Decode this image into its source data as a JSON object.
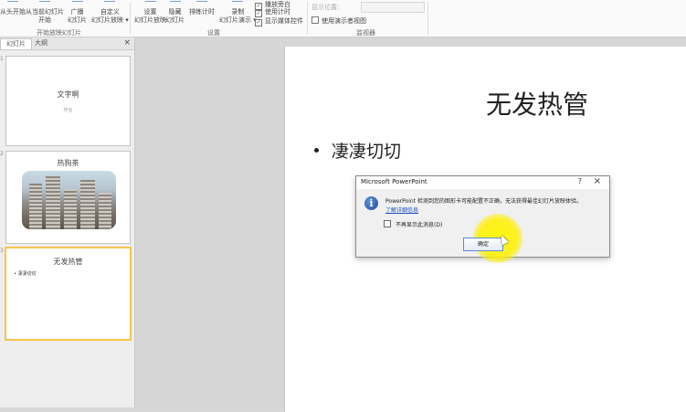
{
  "ribbon": {
    "buttons": [
      {
        "line1": "从头开始",
        "line2": ""
      },
      {
        "line1": "从当前幻灯片",
        "line2": "开始"
      },
      {
        "line1": "广播",
        "line2": "幻灯片"
      },
      {
        "line1": "自定义",
        "line2": "幻灯片放映 ▾"
      },
      {
        "line1": "设置",
        "line2": "幻灯片放映"
      },
      {
        "line1": "隐藏",
        "line2": "幻灯片"
      },
      {
        "line1": "排练计时",
        "line2": ""
      },
      {
        "line1": "录制",
        "line2": "幻灯片演示 ▾"
      }
    ],
    "checkboxes": [
      {
        "label": "播放旁白",
        "checked": true
      },
      {
        "label": "使用计时",
        "checked": true
      },
      {
        "label": "显示媒体控件",
        "checked": true
      },
      {
        "label": "使用演示者视图",
        "checked": false
      }
    ],
    "monitor_dropdown": "显示位置:",
    "groups": {
      "start": "开始放映幻灯片",
      "setup": "设置",
      "monitors": "监视器"
    }
  },
  "left_panel": {
    "tabs": [
      "幻灯片",
      "大纲"
    ],
    "close": "×",
    "slides": [
      {
        "number": "1",
        "title": "文字啊",
        "subtitle": "作业"
      },
      {
        "number": "2",
        "title": "热狗茶"
      },
      {
        "number": "3",
        "title": "无发热管",
        "bullet": "• 凄凄切切"
      }
    ]
  },
  "slide": {
    "title": "无发热管",
    "bullet": "凄凄切切"
  },
  "dialog": {
    "title": "Microsoft PowerPoint",
    "help": "?",
    "close": "×",
    "icon": "info-icon",
    "message": "PowerPoint 检测到您的图形卡可能配置不正确，无法获得最佳幻灯片放映体验。",
    "link": "了解详细信息",
    "checkbox_label": "不再显示此消息(D)",
    "ok_label": "确定"
  },
  "colors": {
    "selection_border": "#f3c64b",
    "cursor_highlight": "#fff200",
    "link": "#1a4fbf",
    "info_icon": "#1f4f9c"
  }
}
